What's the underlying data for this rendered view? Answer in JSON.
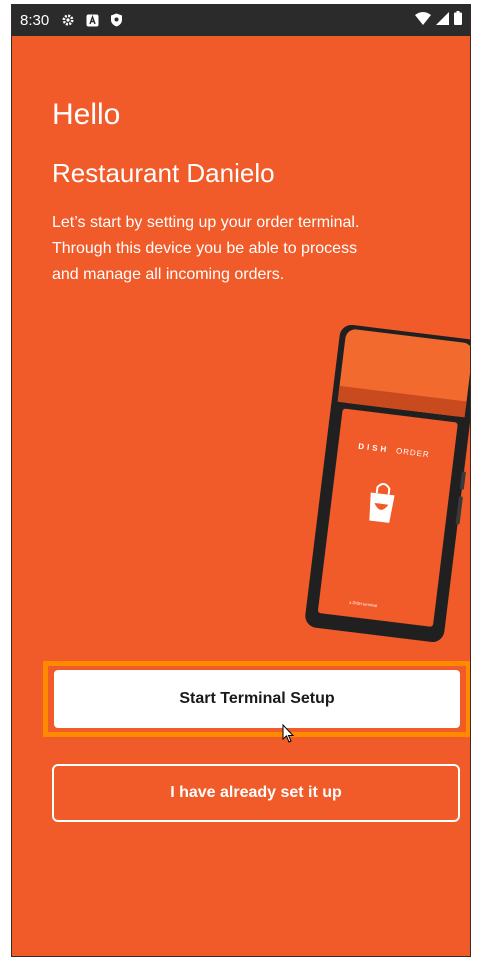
{
  "status_bar": {
    "time": "8:30",
    "left_icons": [
      "gear-icon",
      "notification-a-icon",
      "shield-icon"
    ],
    "right_icons": [
      "wifi-icon",
      "signal-icon",
      "battery-icon"
    ]
  },
  "onboarding": {
    "greeting": "Hello",
    "restaurant_name": "Restaurant Danielo",
    "intro_text": "Let’s start by setting up your order terminal. Through this device you be able to process and manage all incoming orders."
  },
  "device_illustration": {
    "brand": "DISH",
    "brand_suffix": "ORDER",
    "footer": "a DISH terminal"
  },
  "actions": {
    "primary_label": "Start Terminal Setup",
    "secondary_label": "I have already set it up"
  },
  "colors": {
    "background": "#f15a29",
    "highlight": "#ff8a00",
    "status_bar": "#2b2b2b"
  }
}
